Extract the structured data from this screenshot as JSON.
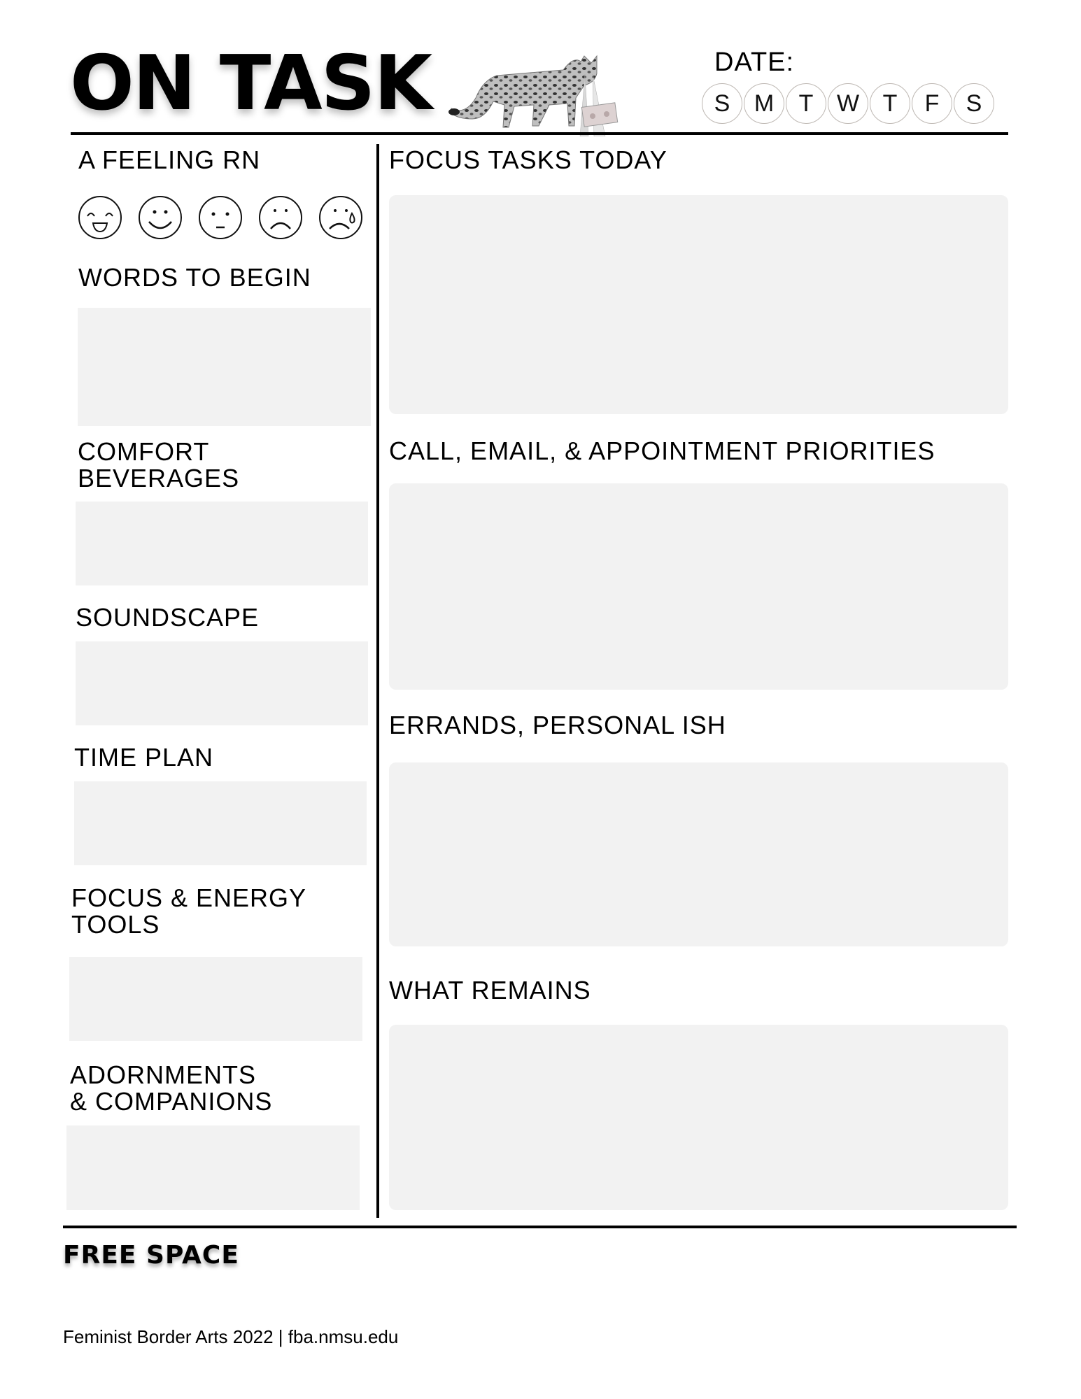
{
  "header": {
    "title": "ON TASK",
    "date_label": "DATE:",
    "days": [
      "S",
      "M",
      "T",
      "W",
      "T",
      "F",
      "S"
    ],
    "illustration": "cat-with-laser-eyes-and-cassette-icon"
  },
  "left_column": {
    "feeling": {
      "label": "A FEELING RN",
      "faces": [
        "laughing-face-icon",
        "smiling-face-icon",
        "neutral-face-icon",
        "sad-face-icon",
        "crying-face-icon"
      ]
    },
    "sections": [
      {
        "label": "WORDS TO BEGIN",
        "value": ""
      },
      {
        "label_line1": "COMFORT",
        "label_line2": "BEVERAGES",
        "value": ""
      },
      {
        "label": "SOUNDSCAPE",
        "value": ""
      },
      {
        "label": "TIME PLAN",
        "value": ""
      },
      {
        "label_line1": "FOCUS & ENERGY",
        "label_line2": "TOOLS",
        "value": ""
      },
      {
        "label_line1": "ADORNMENTS",
        "label_line2": "& COMPANIONS",
        "value": ""
      }
    ]
  },
  "right_column": {
    "sections": [
      {
        "label": "FOCUS TASKS TODAY",
        "value": ""
      },
      {
        "label": "CALL, EMAIL, & APPOINTMENT PRIORITIES",
        "value": ""
      },
      {
        "label": "ERRANDS, PERSONAL ISH",
        "value": ""
      },
      {
        "label": "WHAT REMAINS",
        "value": ""
      }
    ]
  },
  "free_space": {
    "label": "FREE SPACE",
    "value": ""
  },
  "footer": {
    "text": "Feminist Border Arts 2022 | fba.nmsu.edu"
  },
  "colors": {
    "box_fill": "#f2f2f2",
    "line": "#000000",
    "day_circle": "#bdb7b2"
  }
}
